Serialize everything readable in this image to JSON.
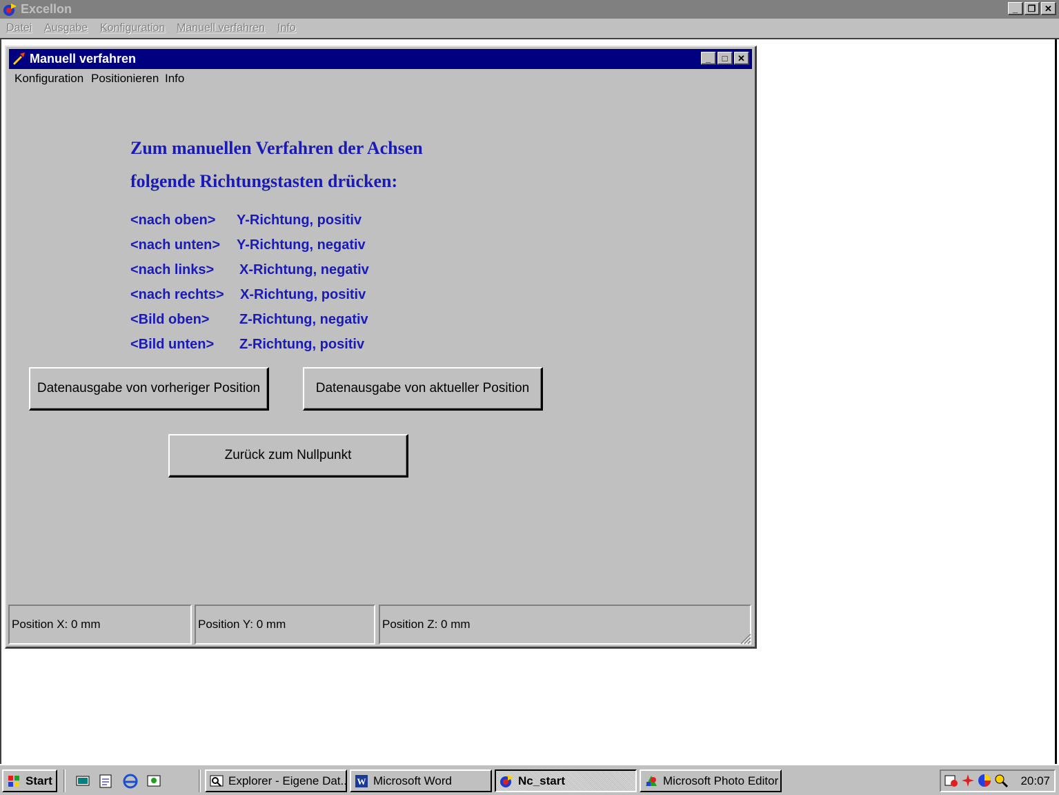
{
  "app": {
    "title": "Excellon",
    "menu": [
      "Datei",
      "Ausgabe",
      "Konfiguration",
      "Manuell verfahren",
      "Info"
    ],
    "window_buttons": {
      "minimize": "_",
      "restore": "❐",
      "close": "✕"
    }
  },
  "child": {
    "title": "Manuell verfahren",
    "menu": [
      "Konfiguration",
      "Positionieren",
      "Info"
    ],
    "heading_line1": "Zum manuellen Verfahren der Achsen",
    "heading_line2": "folgende Richtungstasten drücken:",
    "keys": [
      {
        "key": "<nach oben>",
        "desc": "Y-Richtung, positiv"
      },
      {
        "key": "<nach unten>",
        "desc": "Y-Richtung, negativ"
      },
      {
        "key": "<nach links>",
        "desc": "X-Richtung, negativ"
      },
      {
        "key": "<nach rechts>",
        "desc": "X-Richtung, positiv"
      },
      {
        "key": "<Bild oben>",
        "desc": "Z-Richtung, negativ"
      },
      {
        "key": "<Bild unten>",
        "desc": "Z-Richtung, positiv"
      }
    ],
    "buttons": {
      "prev_position": "Datenausgabe von vorheriger Position",
      "current_position": "Datenausgabe von aktueller Position",
      "back_to_zero": "Zurück zum Nullpunkt"
    },
    "status": {
      "x": "Position X: 0 mm",
      "y": "Position Y: 0 mm",
      "z": "Position Z: 0 mm"
    }
  },
  "taskbar": {
    "start": "Start",
    "quick_launch": [
      "show-desktop-icon",
      "notepad-icon",
      "internet-explorer-icon",
      "channels-icon"
    ],
    "tasks": [
      {
        "label": "Explorer - Eigene Dat...",
        "icon": "explorer-icon",
        "active": false
      },
      {
        "label": "Microsoft Word",
        "icon": "word-icon",
        "active": false
      },
      {
        "label": "Nc_start",
        "icon": "nc-start-icon",
        "active": true
      },
      {
        "label": "Microsoft Photo Editor",
        "icon": "photo-editor-icon",
        "active": false
      }
    ],
    "clock": "20:07"
  },
  "colors": {
    "heading_blue": "#1a1ab4",
    "title_bar_active": "#000080",
    "title_bar_inactive": "#808080",
    "face": "#c0c0c0"
  }
}
